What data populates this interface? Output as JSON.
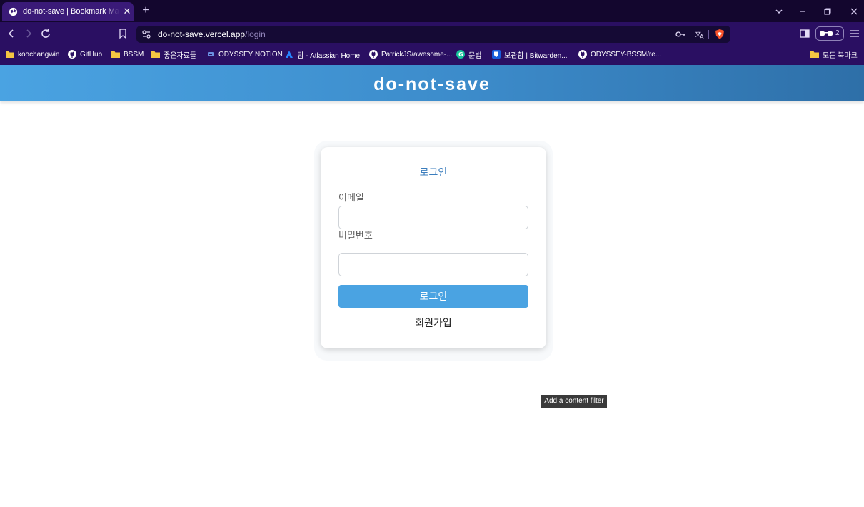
{
  "browser": {
    "tab": {
      "title": "do-not-save | Bookmark Manager"
    },
    "url": {
      "host": "do-not-save.vercel.app",
      "path": "/login"
    },
    "shields_count": "2",
    "bookmarks": [
      {
        "label": "koochangwin",
        "icon": "folder-icon"
      },
      {
        "label": "GitHub",
        "icon": "github-icon"
      },
      {
        "label": "BSSM",
        "icon": "folder-icon"
      },
      {
        "label": "좋은자료들",
        "icon": "folder-icon"
      },
      {
        "label": "ODYSSEY NOTION",
        "icon": "notion-icon"
      },
      {
        "label": "팀 - Atlassian Home",
        "icon": "atlassian-icon"
      },
      {
        "label": "PatrickJS/awesome-...",
        "icon": "github-icon"
      },
      {
        "label": "문법",
        "icon": "grammarly-icon"
      },
      {
        "label": "보관함 | Bitwarden...",
        "icon": "bitwarden-icon"
      },
      {
        "label": "ODYSSEY-BSSM/re...",
        "icon": "github-icon"
      }
    ],
    "all_bookmarks": "모든 북마크"
  },
  "header": {
    "title": "do-not-save"
  },
  "login_form": {
    "title": "로그인",
    "email_label": "이메일",
    "email_value": "",
    "password_label": "비밀번호",
    "password_value": "",
    "submit_label": "로그인",
    "signup_label": "회원가입"
  },
  "tooltip": {
    "text": "Add a content filter"
  },
  "colors": {
    "header_gradient_start": "#4aa3e2",
    "header_gradient_end": "#2e6fa8",
    "button": "#4aa3e2",
    "form_title": "#3b7dbd",
    "browser_chrome": "#2a0f62"
  }
}
